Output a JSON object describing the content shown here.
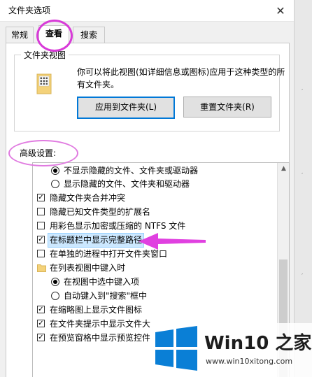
{
  "window": {
    "title": "文件夹选项",
    "close_glyph": "✕"
  },
  "tabs": [
    {
      "label": "常规"
    },
    {
      "label": "查看"
    },
    {
      "label": "搜索"
    }
  ],
  "folder_views": {
    "title": "文件夹视图",
    "description": "你可以将此视图(如详细信息或图标)应用于这种类型的所有文件夹。",
    "apply_button": "应用到文件夹(L)",
    "reset_button": "重置文件夹(R)"
  },
  "advanced": {
    "label": "高级设置:",
    "items": [
      {
        "type": "radio",
        "checked": true,
        "label": "不显示隐藏的文件、文件夹或驱动器"
      },
      {
        "type": "radio",
        "checked": false,
        "label": "显示隐藏的文件、文件夹和驱动器"
      },
      {
        "type": "checkbox",
        "checked": true,
        "label": "隐藏文件夹合并冲突"
      },
      {
        "type": "checkbox",
        "checked": false,
        "label": "隐藏已知文件类型的扩展名"
      },
      {
        "type": "checkbox",
        "checked": false,
        "label": "用彩色显示加密或压缩的 NTFS 文件"
      },
      {
        "type": "checkbox",
        "checked": true,
        "label": "在标题栏中显示完整路径",
        "selected": true
      },
      {
        "type": "checkbox",
        "checked": false,
        "label": "在单独的进程中打开文件夹窗口"
      },
      {
        "type": "folder",
        "label": "在列表视图中键入时"
      },
      {
        "type": "radio",
        "checked": true,
        "label": "在视图中选中键入项"
      },
      {
        "type": "radio",
        "checked": false,
        "label": "自动键入到\"搜索\"框中"
      },
      {
        "type": "checkbox",
        "checked": true,
        "label": "在缩略图上显示文件图标"
      },
      {
        "type": "checkbox",
        "checked": true,
        "label": "在文件夹提示中显示文件大"
      },
      {
        "type": "checkbox",
        "checked": true,
        "label": "在预览窗格中显示预览控件"
      }
    ]
  },
  "watermark": {
    "brand": "Win10 之家",
    "url": "www.win10xitong.com"
  },
  "colors": {
    "annotation_magenta": "#e040e0",
    "selection": "#cce8ff",
    "windows_blue": "#0078d7"
  }
}
